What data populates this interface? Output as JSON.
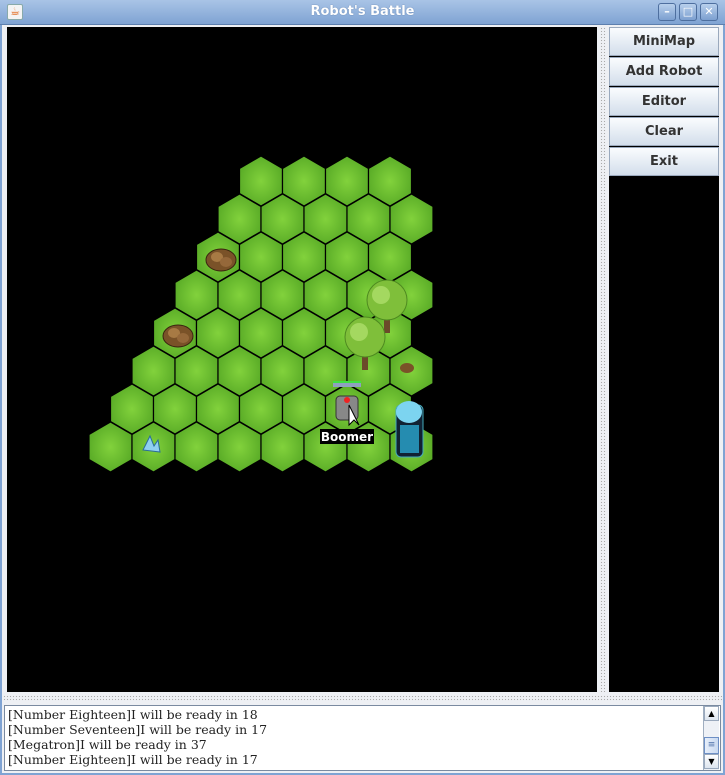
{
  "window": {
    "title": "Robot's Battle",
    "minimize": "–",
    "maximize": "□",
    "close": "✕",
    "icon": "java-icon"
  },
  "sidebar": {
    "buttons": [
      {
        "label": "MiniMap"
      },
      {
        "label": "Add Robot"
      },
      {
        "label": "Editor"
      },
      {
        "label": "Clear"
      },
      {
        "label": "Exit"
      }
    ]
  },
  "map": {
    "terrain": "grass",
    "robot": {
      "name": "Boomer",
      "health": 1.0
    },
    "objects": [
      "rock",
      "rock",
      "tree",
      "tree",
      "stump",
      "crystal",
      "capsule"
    ],
    "colors": {
      "grass": "#6fc430",
      "background": "#000000"
    }
  },
  "log": {
    "lines": [
      "[Number Eighteen]I will be ready in 18",
      "[Number Seventeen]I will be ready in 17",
      "[Megatron]I will be ready in 37",
      "[Number Eighteen]I will be ready in 17"
    ]
  }
}
